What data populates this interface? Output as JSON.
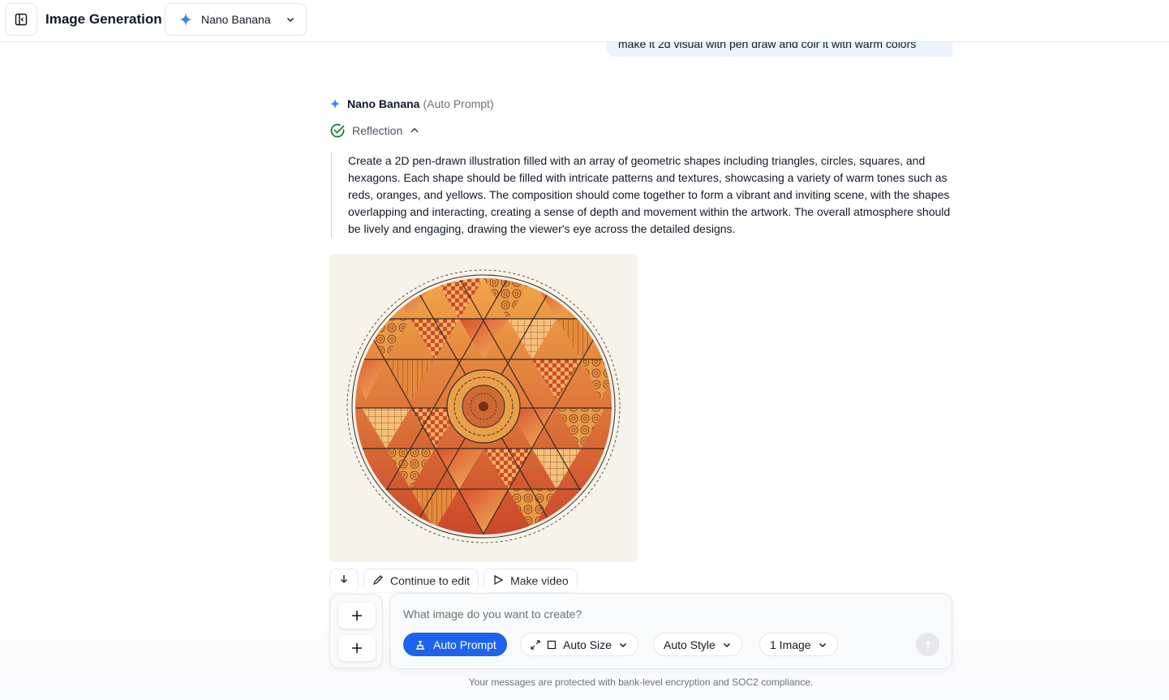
{
  "header": {
    "title": "Image Generation",
    "model": "Nano Banana"
  },
  "user_message": {
    "text": "make it 2d visual with pen draw and coir it with warm colors"
  },
  "assistant": {
    "name": "Nano Banana",
    "mode": "(Auto Prompt)",
    "reflection_label": "Reflection",
    "reflection_text": "Create a 2D pen-drawn illustration filled with an array of geometric shapes including triangles, circles, squares, and hexagons. Each shape should be filled with intricate patterns and textures, showcasing a variety of warm tones such as reds, oranges, and yellows. The composition should come together to form a vibrant and inviting scene, with the shapes overlapping and interacting, creating a sense of depth and movement within the artwork. The overall atmosphere should be lively and engaging, drawing the viewer's eye across the detailed designs.",
    "actions": {
      "continue_edit": "Continue to edit",
      "make_video": "Make video"
    }
  },
  "composer": {
    "placeholder": "What image do you want to create?",
    "auto_prompt": "Auto Prompt",
    "auto_size": "Auto Size",
    "auto_style": "Auto Style",
    "image_count": "1 Image"
  },
  "footer": {
    "note": "Your messages are protected with bank-level encryption and SOC2 compliance."
  },
  "colors": {
    "accent": "#1d63ed",
    "check": "#15803d",
    "sparkle": "#3b82f6"
  }
}
